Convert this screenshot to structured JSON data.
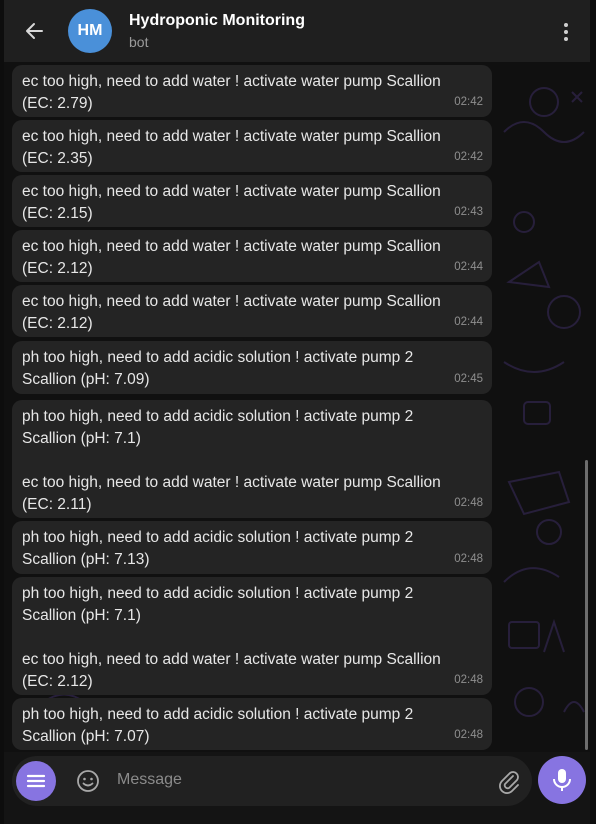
{
  "header": {
    "avatar_initials": "HM",
    "title": "Hydroponic Monitoring",
    "subtitle": "bot"
  },
  "messages": [
    {
      "text": "ec too high, need to add water ! activate water pump Scallion\n(EC: 2.79)",
      "time": "02:42"
    },
    {
      "text": "ec too high, need to add water ! activate water pump Scallion\n(EC: 2.35)",
      "time": "02:42"
    },
    {
      "text": "ec too high, need to add water ! activate water pump Scallion\n(EC: 2.15)",
      "time": "02:43"
    },
    {
      "text": "ec too high, need to add water ! activate water pump Scallion\n(EC: 2.12)",
      "time": "02:44"
    },
    {
      "text": "ec too high, need to add water ! activate water pump Scallion\n(EC: 2.12)",
      "time": "02:44"
    },
    {
      "text": "ph too high, need to add acidic solution ! activate pump 2\nScallion (pH: 7.09)",
      "time": "02:45"
    },
    {
      "text": "ph too high, need to add acidic solution ! activate pump 2\nScallion (pH: 7.1)\n\nec too high, need to add water ! activate water pump Scallion\n(EC: 2.11)",
      "time": "02:48"
    },
    {
      "text": "ph too high, need to add acidic solution ! activate pump 2\nScallion (pH: 7.13)",
      "time": "02:48"
    },
    {
      "text": "ph too high, need to add acidic solution ! activate pump 2\nScallion (pH: 7.1)\n\nec too high, need to add water ! activate water pump Scallion\n(EC: 2.12)",
      "time": "02:48"
    },
    {
      "text": "ph too high, need to add acidic solution ! activate pump 2\nScallion (pH: 7.07)",
      "time": "02:48"
    }
  ],
  "input": {
    "placeholder": "Message"
  },
  "colors": {
    "accent": "#8774e1",
    "avatar": "#4a90d9",
    "bubble": "#242424",
    "background": "#101010"
  },
  "icons": {
    "back": "arrow-left-icon",
    "more": "more-vertical-icon",
    "menu": "bot-menu-icon",
    "emoji": "emoji-icon",
    "attach": "paperclip-icon",
    "mic": "microphone-icon"
  }
}
